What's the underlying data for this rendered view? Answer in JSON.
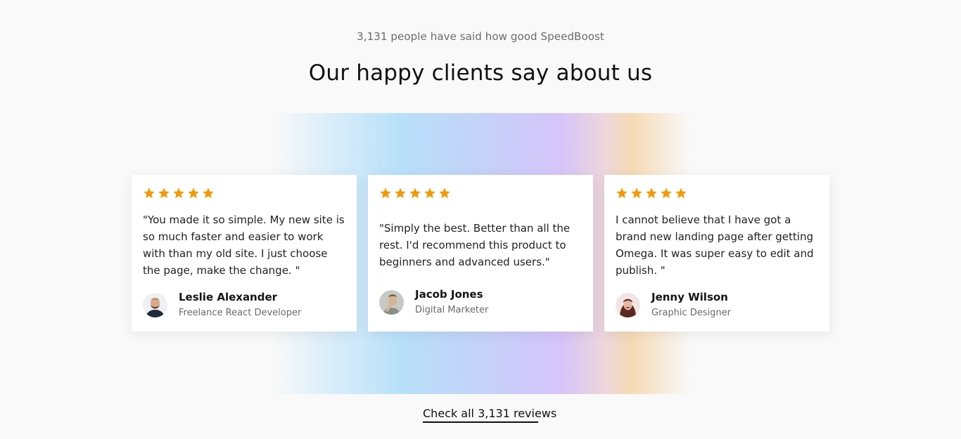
{
  "header": {
    "eyebrow": "3,131 people have said how good SpeedBoost",
    "title": "Our happy clients say about us"
  },
  "colors": {
    "star": "#f2990a",
    "background": "#f9f9f9",
    "card": "#ffffff"
  },
  "testimonials": [
    {
      "rating": 5,
      "quote": "\"You made it so simple. My new site is so much faster and easier to work with than my old site. I just choose the page, make the change. \"",
      "name": "Leslie Alexander",
      "role": "Freelance React Developer",
      "avatar_icon": "man-with-beard-avatar"
    },
    {
      "rating": 5,
      "quote": "\"Simply the best. Better than all the rest. I'd recommend this product to beginners and advanced users.\"",
      "name": "Jacob Jones",
      "role": "Digital Marketer",
      "avatar_icon": "man-thinking-avatar"
    },
    {
      "rating": 5,
      "quote": "I cannot believe that I have got a brand new landing page after getting Omega. It was super easy to edit and publish. \"",
      "name": "Jenny Wilson",
      "role": "Graphic Designer",
      "avatar_icon": "woman-smiling-avatar"
    }
  ],
  "cta": {
    "label": "Check all 3,131 reviews"
  }
}
